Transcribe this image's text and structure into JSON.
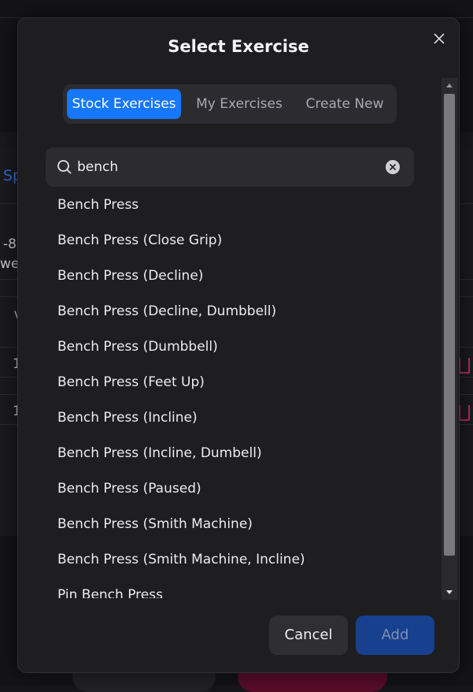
{
  "background": {
    "fragment_sp": "Sp",
    "fragment_range": "-8",
    "fragment_wei": "wei",
    "fragment_v": "V",
    "fragment_row1": "1",
    "fragment_row2": "1"
  },
  "modal": {
    "title": "Select Exercise",
    "tabs": [
      {
        "label": "Stock Exercises",
        "active": true
      },
      {
        "label": "My Exercises",
        "active": false
      },
      {
        "label": "Create New",
        "active": false
      }
    ],
    "search": {
      "value": "bench",
      "icon": "search-icon",
      "clear_icon": "clear-icon"
    },
    "exercises": [
      "Bench Press",
      "Bench Press (Close Grip)",
      "Bench Press (Decline)",
      "Bench Press (Decline, Dumbbell)",
      "Bench Press (Dumbbell)",
      "Bench Press (Feet Up)",
      "Bench Press (Incline)",
      "Bench Press (Incline, Dumbell)",
      "Bench Press (Paused)",
      "Bench Press (Smith Machine)",
      "Bench Press (Smith Machine, Incline)",
      "Pin Bench Press"
    ],
    "buttons": {
      "cancel": "Cancel",
      "add": "Add"
    }
  },
  "colors": {
    "accent": "#1677ff",
    "add_disabled": "#17408e",
    "modal_bg": "#1e1e21"
  }
}
